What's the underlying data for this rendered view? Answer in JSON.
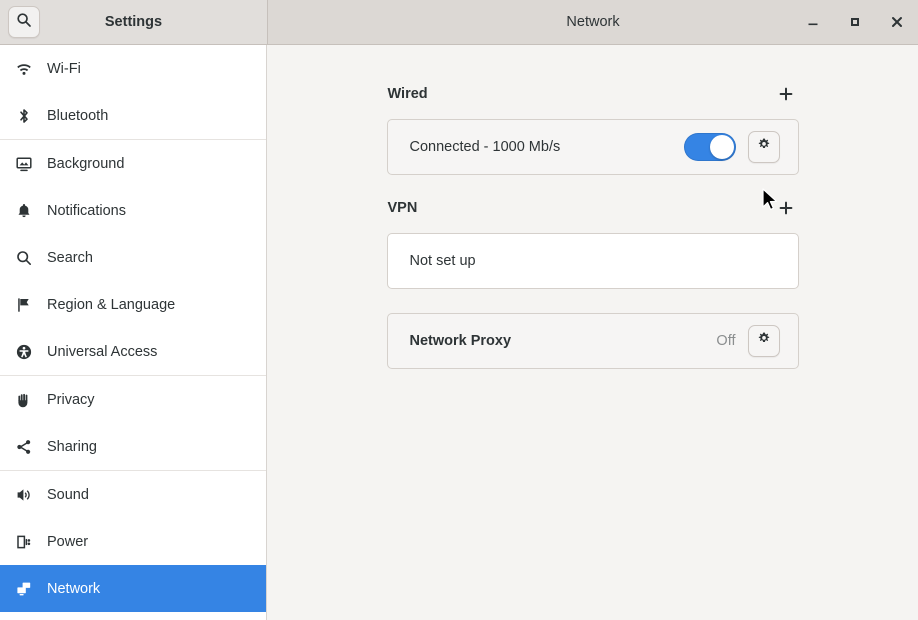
{
  "window": {
    "sidebar_title": "Settings",
    "main_title": "Network",
    "controls": {
      "minimize": "minimize-icon",
      "maximize": "maximize-icon",
      "close": "close-icon"
    },
    "search_icon": "search-icon"
  },
  "sidebar": {
    "items": [
      {
        "label": "Wi-Fi",
        "icon": "wifi-icon",
        "selected": false
      },
      {
        "label": "Bluetooth",
        "icon": "bluetooth-icon",
        "selected": false
      },
      {
        "label": "Background",
        "icon": "background-icon",
        "selected": false
      },
      {
        "label": "Notifications",
        "icon": "bell-icon",
        "selected": false
      },
      {
        "label": "Search",
        "icon": "search-icon",
        "selected": false
      },
      {
        "label": "Region & Language",
        "icon": "flag-icon",
        "selected": false
      },
      {
        "label": "Universal Access",
        "icon": "accessibility-icon",
        "selected": false
      },
      {
        "label": "Privacy",
        "icon": "hand-icon",
        "selected": false
      },
      {
        "label": "Sharing",
        "icon": "share-icon",
        "selected": false
      },
      {
        "label": "Sound",
        "icon": "speaker-icon",
        "selected": false
      },
      {
        "label": "Power",
        "icon": "battery-icon",
        "selected": false
      },
      {
        "label": "Network",
        "icon": "network-icon",
        "selected": true
      }
    ]
  },
  "content": {
    "wired": {
      "title": "Wired",
      "add_label": "+",
      "status": "Connected - 1000 Mb/s",
      "toggle_on": true,
      "settings_icon": "gear-icon"
    },
    "vpn": {
      "title": "VPN",
      "add_label": "+",
      "status": "Not set up"
    },
    "proxy": {
      "title": "Network Proxy",
      "status": "Off",
      "settings_icon": "gear-icon"
    }
  },
  "colors": {
    "accent": "#3584e4",
    "sidebar_bg": "#ffffff",
    "content_bg": "#f5f4f2",
    "headerbar_bg": "#dcd8d4",
    "text": "#2e3436",
    "muted_text": "#8b8e8f"
  }
}
